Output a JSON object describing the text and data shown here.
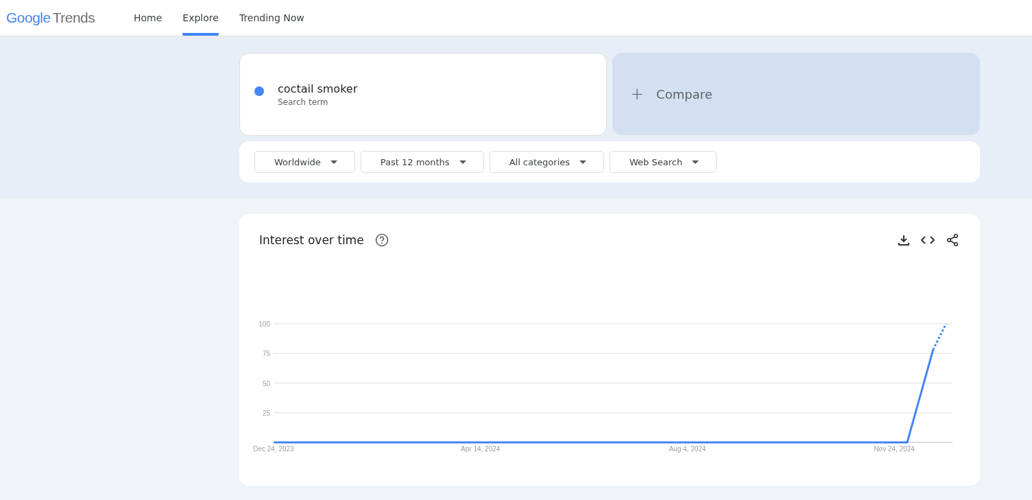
{
  "header": {
    "logo": {
      "word1": "Google",
      "word2": "Trends"
    },
    "nav": [
      {
        "label": "Home",
        "selected": false
      },
      {
        "label": "Explore",
        "selected": true
      },
      {
        "label": "Trending Now",
        "selected": false
      }
    ]
  },
  "search_term": {
    "value": "coctail smoker",
    "subtitle": "Search term",
    "color": "#4285f4"
  },
  "compare": {
    "icon": "+",
    "label": "Compare"
  },
  "filters": [
    {
      "label": "Worldwide"
    },
    {
      "label": "Past 12 months"
    },
    {
      "label": "All categories"
    },
    {
      "label": "Web Search"
    }
  ],
  "interest_over_time": {
    "title": "Interest over time",
    "chart_data": {
      "type": "line",
      "categories": [
        "Dec 24, 2023",
        null,
        null,
        null,
        null,
        null,
        null,
        null,
        null,
        null,
        null,
        null,
        null,
        null,
        null,
        null,
        "Apr 14, 2024",
        null,
        null,
        null,
        null,
        null,
        null,
        null,
        null,
        null,
        null,
        null,
        null,
        null,
        null,
        null,
        "Aug 4, 2024",
        null,
        null,
        null,
        null,
        null,
        null,
        null,
        null,
        null,
        null,
        null,
        null,
        null,
        null,
        null,
        "Nov 24, 2024",
        null,
        null,
        null,
        null
      ],
      "series": [
        {
          "color": "#4285f4",
          "values": [
            0,
            0,
            0,
            0,
            0,
            0,
            0,
            0,
            0,
            0,
            0,
            0,
            0,
            0,
            0,
            0,
            0,
            0,
            0,
            0,
            0,
            0,
            0,
            0,
            0,
            0,
            0,
            0,
            0,
            0,
            0,
            0,
            0,
            0,
            0,
            0,
            0,
            0,
            0,
            0,
            0,
            0,
            0,
            0,
            0,
            0,
            0,
            0,
            0,
            0,
            39,
            78,
            100
          ]
        }
      ],
      "ylim": [
        0,
        100
      ],
      "grid": true,
      "yticks": [
        {
          "value": 25,
          "label": "25"
        },
        {
          "value": 50,
          "label": "50"
        },
        {
          "value": 75,
          "label": "75"
        },
        {
          "value": 100,
          "label": "100"
        }
      ]
    }
  }
}
